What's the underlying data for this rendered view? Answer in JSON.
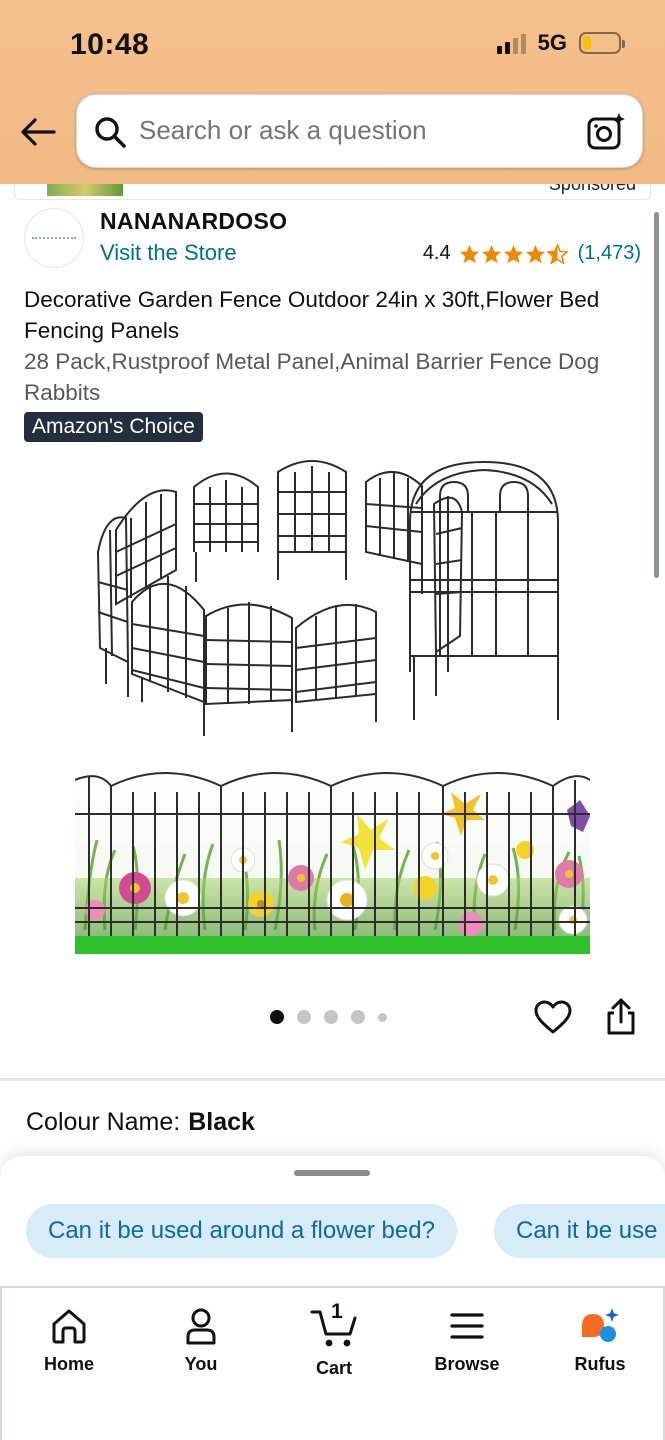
{
  "status_bar": {
    "time": "10:48",
    "network": "5G"
  },
  "search": {
    "placeholder": "Search or ask a question"
  },
  "sponsored_strip": {
    "label": "Sponsored"
  },
  "store": {
    "brand": "NANANARDOSO",
    "visit_label": "Visit the Store"
  },
  "rating": {
    "value": "4.4",
    "stars": 4.4,
    "reviews": "(1,473)"
  },
  "product": {
    "title": "Decorative Garden Fence Outdoor 24in x 30ft,Flower Bed Fencing Panels",
    "subtitle": "28 Pack,Rustproof Metal Panel,Animal Barrier Fence Dog Rabbits",
    "badge": "Amazon's Choice"
  },
  "carousel": {
    "count": 5,
    "active_index": 0
  },
  "colour": {
    "label": "Colour Name:",
    "value": "Black"
  },
  "rufus_chips": [
    "Can it be used around a flower bed?",
    "Can it be use"
  ],
  "bottom_nav": {
    "home": "Home",
    "you": "You",
    "cart": "Cart",
    "cart_count": "1",
    "browse": "Browse",
    "rufus": "Rufus"
  },
  "colors": {
    "header": "#f2ba84",
    "link": "#007185",
    "star": "#f08804",
    "badge": "#232f3e",
    "chip_bg": "#d7ecf7"
  }
}
